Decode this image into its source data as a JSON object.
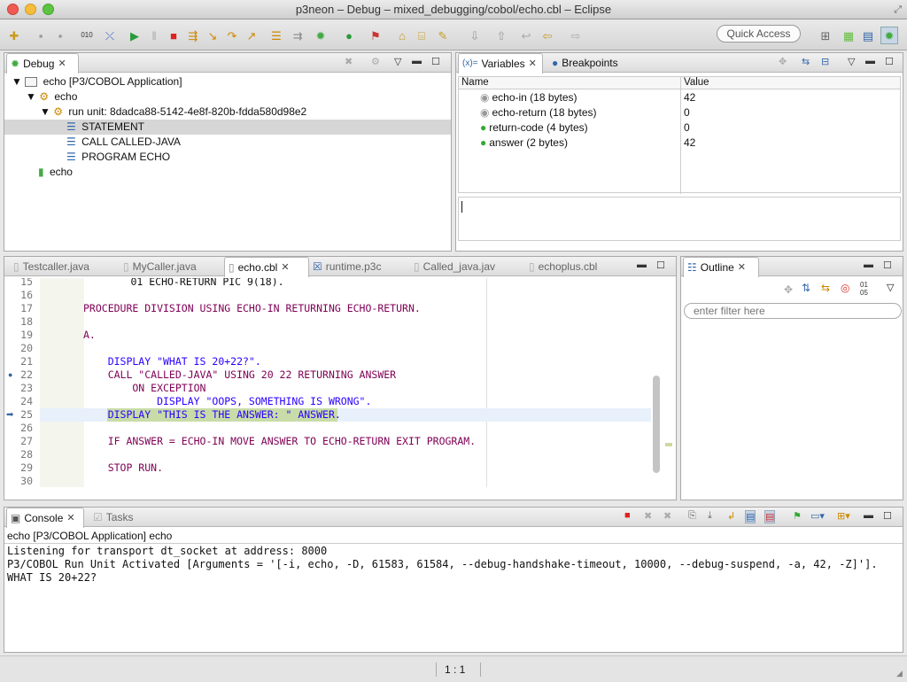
{
  "window": {
    "title": "p3neon – Debug – mixed_debugging/cobol/echo.cbl – Eclipse"
  },
  "toolbar": {
    "quick_access": "Quick Access"
  },
  "debug_view": {
    "tab": "Debug",
    "tree": [
      {
        "label": "echo [P3/COBOL Application]"
      },
      {
        "label": "echo"
      },
      {
        "label": "run unit: 8dadca88-5142-4e8f-820b-fdda580d98e2"
      },
      {
        "label": "STATEMENT"
      },
      {
        "label": "CALL CALLED-JAVA"
      },
      {
        "label": "PROGRAM ECHO"
      },
      {
        "label": "echo"
      }
    ]
  },
  "variables_view": {
    "tabs": [
      "Variables",
      "Breakpoints"
    ],
    "tab_prefix": "(x)=",
    "columns": [
      "Name",
      "Value"
    ],
    "rows": [
      {
        "name": "echo-in (18 bytes)",
        "value": "42"
      },
      {
        "name": "echo-return (18 bytes)",
        "value": "0"
      },
      {
        "name": "return-code (4 bytes)",
        "value": "0"
      },
      {
        "name": "answer (2 bytes)",
        "value": "42"
      }
    ]
  },
  "editor": {
    "tabs": [
      "Testcaller.java",
      "MyCaller.java",
      "echo.cbl",
      "runtime.p3c",
      "Called_java.jav",
      "echoplus.cbl"
    ],
    "lines": [
      {
        "n": "15",
        "text": "       01 ECHO-RETURN PIC 9(18)."
      },
      {
        "n": "16",
        "text": ""
      },
      {
        "n": "17",
        "text": "PROCEDURE DIVISION USING ECHO-IN RETURNING ECHO-RETURN."
      },
      {
        "n": "18",
        "text": ""
      },
      {
        "n": "19",
        "text": "A."
      },
      {
        "n": "20",
        "text": ""
      },
      {
        "n": "21",
        "text": "    DISPLAY \"WHAT IS 20+22?\"."
      },
      {
        "n": "22",
        "text": "    CALL \"CALLED-JAVA\" USING 20 22 RETURNING ANSWER"
      },
      {
        "n": "23",
        "text": "        ON EXCEPTION"
      },
      {
        "n": "24",
        "text": "            DISPLAY \"OOPS, SOMETHING IS WRONG\"."
      },
      {
        "n": "25",
        "text": "    DISPLAY \"THIS IS THE ANSWER: \" ANSWER."
      },
      {
        "n": "26",
        "text": ""
      },
      {
        "n": "27",
        "text": "    IF ANSWER = ECHO-IN MOVE ANSWER TO ECHO-RETURN EXIT PROGRAM."
      },
      {
        "n": "28",
        "text": ""
      },
      {
        "n": "29",
        "text": "    STOP RUN."
      },
      {
        "n": "30",
        "text": ""
      }
    ]
  },
  "outline_view": {
    "tab": "Outline",
    "filter_placeholder": "enter filter here",
    "sort_label": "01\n05"
  },
  "console_view": {
    "tabs": [
      "Console",
      "Tasks"
    ],
    "process": "echo [P3/COBOL Application] echo",
    "output": [
      "Listening for transport dt_socket at address: 8000",
      "P3/COBOL Run Unit Activated [Arguments = '[-i, echo, -D, 61583, 61584, --debug-handshake-timeout, 10000, --debug-suspend, -a, 42, -Z]'].",
      "WHAT IS 20+22?"
    ]
  },
  "statusbar": {
    "position": "1 : 1"
  }
}
